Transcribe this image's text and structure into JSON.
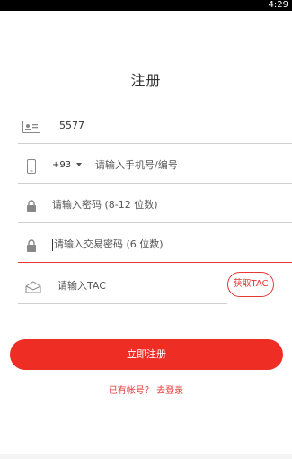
{
  "status_bar": {
    "time": "4:29"
  },
  "page": {
    "title": "注册"
  },
  "fields": {
    "account_value": "5577",
    "country_code": "+93",
    "phone_placeholder": "请输入手机号/编号",
    "password_placeholder": "请输入密码 (8-12 位数)",
    "trade_password_placeholder": "请输入交易密码 (6 位数)",
    "tac_placeholder": "请输入TAC"
  },
  "buttons": {
    "get_tac": "获取TAC",
    "register": "立即注册",
    "login_link": "已有帐号？ 去登录"
  },
  "icons": {
    "account": "id-card-icon",
    "phone": "phone-icon",
    "lock": "lock-icon",
    "tac": "envelope-icon"
  },
  "colors": {
    "accent": "#ee2d24",
    "accent_text": "#e53935",
    "divider": "#cfcfcf"
  }
}
